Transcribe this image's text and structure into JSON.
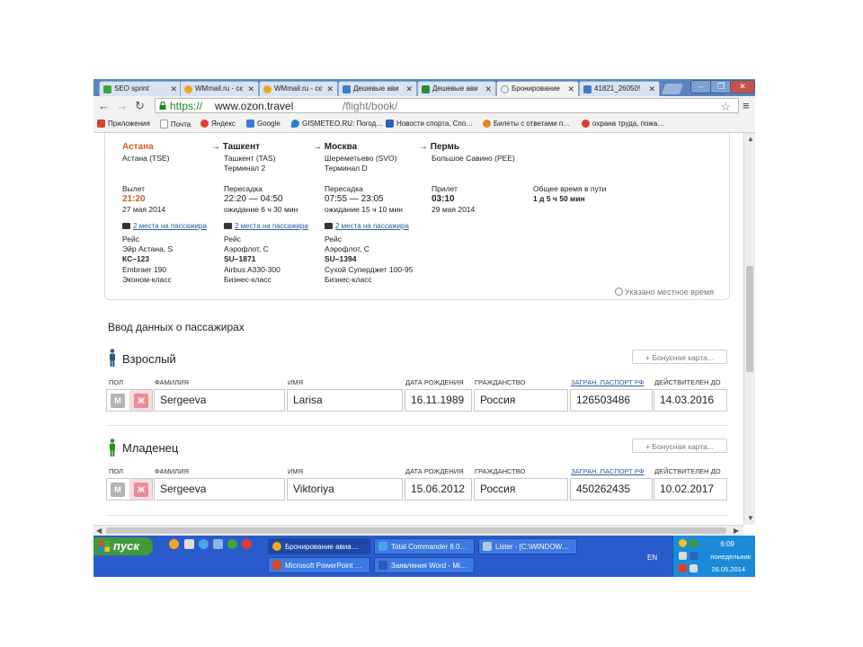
{
  "browser": {
    "tabs": [
      {
        "label": "SEO sprint",
        "color": "#3aa640"
      },
      {
        "label": "WMmail.ru - сє",
        "color": "#f0a81e"
      },
      {
        "label": "WMmail.ru - сє",
        "color": "#f0a81e"
      },
      {
        "label": "Дешевые ави",
        "color": "#2f7fc9"
      },
      {
        "label": "Дешевые ави",
        "color": "#2f8a3a"
      },
      {
        "label": "Бронирование",
        "color": "#5f9ad6"
      },
      {
        "label": "41821_26050!",
        "color": "#3a7cc6"
      }
    ],
    "url_scheme": "https://",
    "url_host": "www.ozon.travel",
    "url_path": "/flight/book/",
    "bookmarks": [
      {
        "label": "Приложения",
        "icon": "apps-icon",
        "color": "#d2452c"
      },
      {
        "label": "Почта",
        "icon": "page-icon",
        "color": "#dddddd"
      },
      {
        "label": "Яндекс",
        "icon": "yandex-icon",
        "color": "#e33b2e"
      },
      {
        "label": "Google",
        "icon": "google-icon",
        "color": "#3c78d8"
      },
      {
        "label": "GISMETEO.RU: Погод…",
        "icon": "weather-icon",
        "color": "#2c7fd1"
      },
      {
        "label": "Новости спорта, Спо…",
        "icon": "sport-icon",
        "color": "#2a63b8"
      },
      {
        "label": "Билеты с ответами п…",
        "icon": "ticket-icon",
        "color": "#e38a1c"
      },
      {
        "label": "охрана труда, пожа…",
        "icon": "safety-icon",
        "color": "#d6402f"
      }
    ]
  },
  "flight": {
    "segments": [
      {
        "city": "Астана",
        "city_accent": true,
        "arrow": "",
        "airport": "Астана (TSE)",
        "terminal": "",
        "stage_label": "Вылет",
        "time": "21:20",
        "time_accent": true,
        "wait": "",
        "date": "27 мая 2014",
        "seats": "2 места на пассажира",
        "flight_label": "Рейс",
        "carrier": "Эйр Астана, S",
        "number": "КС–123",
        "aircraft": "Embraer 190",
        "cabin": "Эконом-класс"
      },
      {
        "city": "Ташкент",
        "city_accent": false,
        "arrow": "→",
        "airport": "Ташкент (TAS)",
        "terminal": "Терминал 2",
        "stage_label": "Пересадка",
        "time": "22:20 — 04:50",
        "time_accent": false,
        "wait": "ожидание 6 ч 30 мин",
        "date": "",
        "seats": "2 места на пассажира",
        "flight_label": "Рейс",
        "carrier": "Аэрофлот, С",
        "number": "SU–1871",
        "aircraft": "Airbus A330-300",
        "cabin": "Бизнес-класс"
      },
      {
        "city": "Москва",
        "city_accent": false,
        "arrow": "→",
        "airport": "Шереметьево (SVO)",
        "terminal": "Терминал D",
        "stage_label": "Пересадка",
        "time": "07:55 — 23:05",
        "time_accent": false,
        "wait": "ожидание 15 ч 10 мин",
        "date": "",
        "seats": "2 места на пассажира",
        "flight_label": "Рейс",
        "carrier": "Аэрофлот, С",
        "number": "SU–1394",
        "aircraft": "Сухой Суперджет 100-95",
        "cabin": "Бизнес-класс"
      },
      {
        "city": "Пермь",
        "city_accent": false,
        "arrow": "→",
        "airport": "Большое Савино (PEE)",
        "terminal": "",
        "stage_label": "Прилет",
        "time": "03:10",
        "time_accent": false,
        "wait": "",
        "date": "29 мая 2014",
        "seats": "",
        "flight_label": "",
        "carrier": "",
        "number": "",
        "aircraft": "",
        "cabin": ""
      }
    ],
    "total_label": "Общее время в пути",
    "total_value": "1 д 5 ч 50 мин",
    "local_time_note": "Указано местное время"
  },
  "passengers_section_title": "Ввод данных о пассажирах",
  "field_labels": {
    "gender": "ПОЛ",
    "surname": "ФАМИЛИЯ",
    "name": "ИМЯ",
    "birth": "ДАТА РОЖДЕНИЯ",
    "citizenship": "ГРАЖДАНСТВО",
    "passport": "ЗАГРАН. ПАСПОРТ РФ",
    "valid": "ДЕЙСТВИТЕЛЕН ДО"
  },
  "gender_male": "М",
  "gender_female": "Ж",
  "bonus_card": "+ Бонусная карта...",
  "passengers": [
    {
      "type": "Взрослый",
      "icon_color": "#1f5d8c",
      "surname": "Sergeeva",
      "name": "Larisa",
      "birth": "16.11.1989",
      "citizenship": "Россия",
      "passport": "126503486",
      "valid": "14.03.2016"
    },
    {
      "type": "Младенец",
      "icon_color": "#2e8b2e",
      "surname": "Sergeeva",
      "name": "Viktoriya",
      "birth": "15.06.2012",
      "citizenship": "Россия",
      "passport": "450262435",
      "valid": "10.02.2017"
    }
  ],
  "taskbar": {
    "start": "пуск",
    "windows": [
      {
        "label": "Бронирование авиа…",
        "color": "#f0a81e"
      },
      {
        "label": "Total Commander 8.0…",
        "color": "#4aa5e8"
      },
      {
        "label": "Lister - [C:\\WINDOW…",
        "color": "#b0c8e8"
      },
      {
        "label": "Microsoft PowerPoint …",
        "color": "#d24a2a"
      },
      {
        "label": "Заявления Word - Mi…",
        "color": "#2a5bb8"
      }
    ],
    "lang": "EN",
    "time": "6:09",
    "day": "понедельник",
    "date": "26.05.2014"
  }
}
